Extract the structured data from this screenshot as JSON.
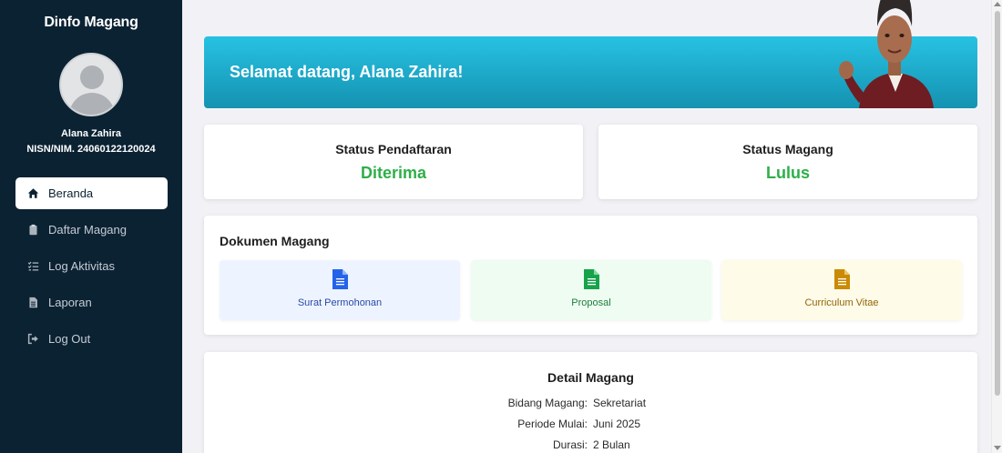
{
  "sidebar": {
    "brand": "Dinfo Magang",
    "user_name": "Alana Zahira",
    "user_id": "NISN/NIM. 24060122120024",
    "items": [
      {
        "label": "Beranda",
        "icon": "home-icon",
        "active": true
      },
      {
        "label": "Daftar Magang",
        "icon": "clipboard-icon",
        "active": false
      },
      {
        "label": "Log Aktivitas",
        "icon": "list-check-icon",
        "active": false
      },
      {
        "label": "Laporan",
        "icon": "file-icon",
        "active": false
      },
      {
        "label": "Log Out",
        "icon": "logout-icon",
        "active": false
      }
    ]
  },
  "banner": {
    "title": "Selamat datang, Alana Zahira!"
  },
  "status": {
    "registration": {
      "label": "Status Pendaftaran",
      "value": "Diterima"
    },
    "internship": {
      "label": "Status Magang",
      "value": "Lulus"
    }
  },
  "documents": {
    "title": "Dokumen Magang",
    "items": [
      {
        "label": "Surat Permohonan",
        "icon": "document-icon",
        "color": "#2563eb",
        "bg": "#eef4ff"
      },
      {
        "label": "Proposal",
        "icon": "document-icon",
        "color": "#16a34a",
        "bg": "#eefcf2"
      },
      {
        "label": "Curriculum Vitae",
        "icon": "document-icon",
        "color": "#ca8a04",
        "bg": "#fefbe8"
      }
    ]
  },
  "detail": {
    "title": "Detail Magang",
    "rows": [
      {
        "key": "Bidang Magang:",
        "value": "Sekretariat"
      },
      {
        "key": "Periode Mulai:",
        "value": "Juni 2025"
      },
      {
        "key": "Durasi:",
        "value": "2 Bulan"
      }
    ]
  },
  "colors": {
    "sidebar_bg": "#0b2233",
    "banner_start": "#27c2e3",
    "banner_end": "#1592b1",
    "status_green": "#2eaf49"
  }
}
